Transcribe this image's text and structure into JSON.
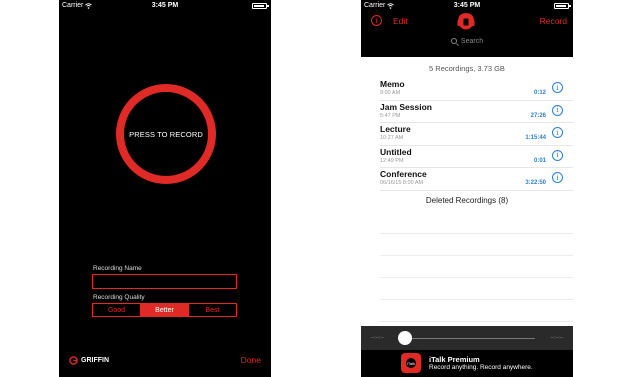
{
  "left_screen": {
    "status": {
      "carrier": "Carrier",
      "time": "3:45 PM"
    },
    "record_button_label": "PRESS TO RECORD",
    "recording_name_label": "Recording Name",
    "recording_name_value": "",
    "recording_quality_label": "Recording Quality",
    "quality_options": [
      "Good",
      "Better",
      "Best"
    ],
    "quality_selected": "Better",
    "brand": "GRIFFIN",
    "done_label": "Done"
  },
  "right_screen": {
    "status": {
      "carrier": "Carrier",
      "time": "3:45 PM"
    },
    "edit_label": "Edit",
    "record_label": "Record",
    "search_placeholder": "Search",
    "summary": "5 Recordings, 3.73 GB",
    "recordings": [
      {
        "name": "Memo",
        "time": "9:00 AM",
        "duration": "0:12"
      },
      {
        "name": "Jam Session",
        "time": "5:47 PM",
        "duration": "27:26"
      },
      {
        "name": "Lecture",
        "time": "10:27 AM",
        "duration": "1:15:44"
      },
      {
        "name": "Untitled",
        "time": "12:49 PM",
        "duration": "0:01"
      },
      {
        "name": "Conference",
        "time": "06/16/15 8:00 AM",
        "duration": "3:22:50"
      }
    ],
    "deleted_label": "Deleted Recordings (8)",
    "player": {
      "elapsed": "--:--:--",
      "remaining": "--:--:--"
    },
    "promo": {
      "title": "iTalk Premium",
      "subtitle": "Record anything. Record anywhere."
    }
  },
  "colors": {
    "accent": "#e02a26",
    "link_blue": "#2d7fd4"
  }
}
